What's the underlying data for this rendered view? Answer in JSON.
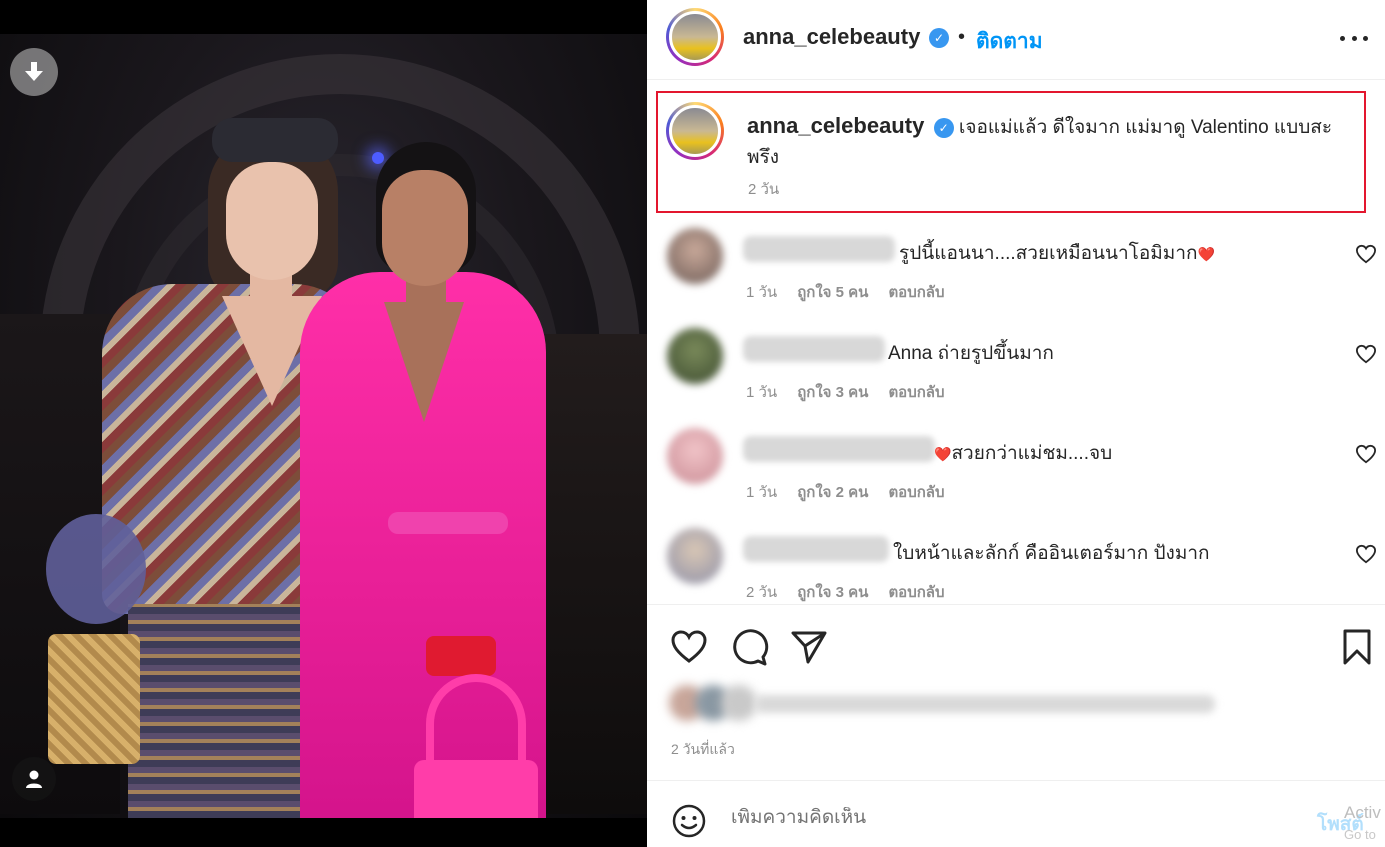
{
  "post": {
    "username": "anna_celebeauty",
    "verified_glyph": "✓",
    "dot": "•",
    "follow_label": "ติดตาม",
    "caption": "เจอแม่แล้ว ดีใจมาก แม่มาดู Valentino แบบสะพรึง",
    "caption_time": "2 วัน",
    "post_time": "2 วันที่แล้ว"
  },
  "comments": [
    {
      "text": "รูปนี้แอนนา....สวยเหมือนนาโอมิมาก",
      "emoji": "❤️",
      "time": "1 วัน",
      "likes": "ถูกใจ 5 คน",
      "reply": "ตอบกลับ"
    },
    {
      "text": "Anna ถ่ายรูปขึ้นมาก",
      "emoji": "",
      "time": "1 วัน",
      "likes": "ถูกใจ 3 คน",
      "reply": "ตอบกลับ"
    },
    {
      "text": "สวยกว่าแม่ชม....จบ",
      "emoji": "❤️",
      "time": "1 วัน",
      "likes": "ถูกใจ 2 คน",
      "reply": "ตอบกลับ"
    },
    {
      "text": "ใบหน้าและลักก์ คืออินเตอร์มาก ปังมาก",
      "emoji": "",
      "time": "2 วัน",
      "likes": "ถูกใจ 3 คน",
      "reply": "ตอบกลับ"
    }
  ],
  "comment_bar": {
    "placeholder": "เพิ่มความคิดเห็น",
    "post_label": "โพสต์"
  },
  "watermark": {
    "line1": "Activ",
    "line2": "Go to"
  },
  "icons": {
    "download": "download-icon",
    "tag": "user-tag-icon",
    "more": "more-options-icon",
    "like": "heart-icon",
    "comment": "comment-icon",
    "share": "share-icon",
    "save": "bookmark-icon",
    "emoji": "emoji-icon"
  },
  "colors": {
    "accent": "#0095f6",
    "verified": "#3897f0",
    "highlight_border": "#e3162e",
    "muted_text": "#8e8e8e"
  }
}
